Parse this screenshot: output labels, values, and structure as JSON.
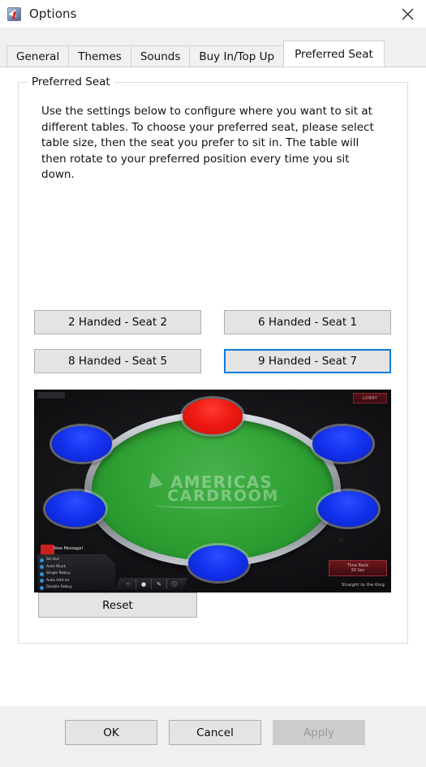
{
  "window": {
    "title": "Options",
    "icon": "poker-app-icon",
    "close_label": "close-icon"
  },
  "tabs": [
    {
      "label": "General",
      "active": false
    },
    {
      "label": "Themes",
      "active": false
    },
    {
      "label": "Sounds",
      "active": false
    },
    {
      "label": "Buy In/Top Up",
      "active": false
    },
    {
      "label": "Preferred Seat",
      "active": true
    }
  ],
  "group": {
    "legend": "Preferred Seat",
    "description": "Use the settings below to configure where you want to sit at different tables. To choose your preferred seat, please select table size, then the seat you prefer to sit in. The table will then rotate to your preferred position every time you sit down."
  },
  "seat_buttons": [
    {
      "label": "2 Handed - Seat 2",
      "selected": false
    },
    {
      "label": "6 Handed - Seat 1",
      "selected": false
    },
    {
      "label": "8 Handed - Seat 5",
      "selected": false
    },
    {
      "label": "9 Handed - Seat 7",
      "selected": true
    }
  ],
  "table_preview": {
    "brand_line1": "AMERICAS",
    "brand_line2": "CARDROOM",
    "lobby_label": "LOBBY",
    "new_message_label": "New Message!",
    "time_bank_label": "Time Bank",
    "time_bank_value": "30 Sec",
    "tagline": "Straight to the King",
    "options": [
      "Sit Out",
      "Auto Muck",
      "Single Rebuy",
      "Auto Add-on",
      "Double Rebuy"
    ],
    "toolbar_icons": [
      "hand-icon",
      "chat-icon",
      "note-icon",
      "info-icon"
    ],
    "seats": [
      {
        "position": "top-center",
        "color": "#ef1a12",
        "selected": true
      },
      {
        "position": "left-upper",
        "color": "#1433f0",
        "selected": false
      },
      {
        "position": "left-lower",
        "color": "#1433f0",
        "selected": false
      },
      {
        "position": "right-upper",
        "color": "#1433f0",
        "selected": false
      },
      {
        "position": "right-lower",
        "color": "#1433f0",
        "selected": false
      },
      {
        "position": "bottom-center",
        "color": "#1433f0",
        "selected": false
      }
    ]
  },
  "reset": {
    "label": "Reset"
  },
  "footer": {
    "ok": "OK",
    "cancel": "Cancel",
    "apply": "Apply",
    "apply_disabled": true
  },
  "colors": {
    "accent": "#0f7ddb",
    "felt_green": "#31a235",
    "seat_blue": "#1433f0",
    "seat_red": "#ef1a12",
    "dialog_bg": "#f0f0f0"
  }
}
